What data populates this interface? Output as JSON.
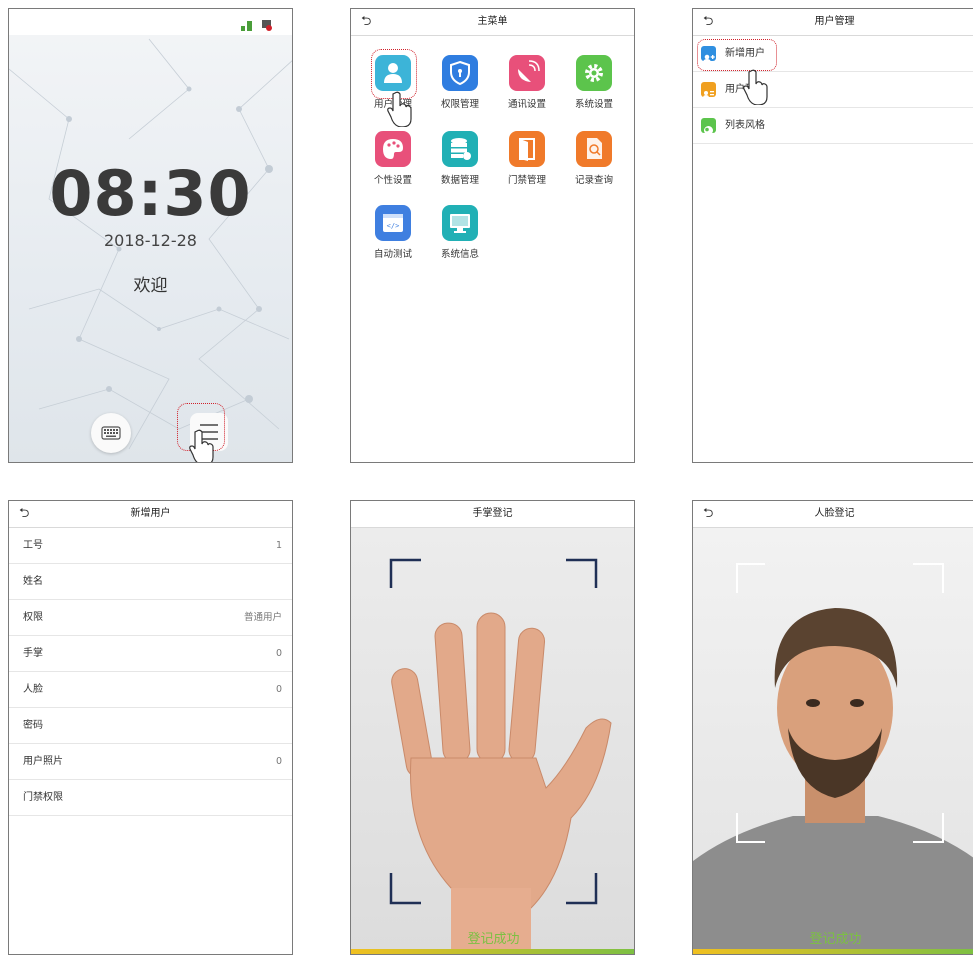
{
  "standby": {
    "time": "08:30",
    "date": "2018-12-28",
    "welcome": "欢迎",
    "keyboard_icon": "keyboard-icon",
    "menu_icon": "hamburger-menu-icon"
  },
  "main_menu": {
    "title": "主菜单",
    "items": [
      {
        "label": "用户管理",
        "icon": "user-icon",
        "color": "#3cb4d8"
      },
      {
        "label": "权限管理",
        "icon": "shield-icon",
        "color": "#2f7de0"
      },
      {
        "label": "通讯设置",
        "icon": "satellite-icon",
        "color": "#e8507a"
      },
      {
        "label": "系统设置",
        "icon": "gear-icon",
        "color": "#5cc44c"
      },
      {
        "label": "个性设置",
        "icon": "palette-icon",
        "color": "#e8507a"
      },
      {
        "label": "数据管理",
        "icon": "database-icon",
        "color": "#21b0b5"
      },
      {
        "label": "门禁管理",
        "icon": "door-icon",
        "color": "#f07a2a"
      },
      {
        "label": "记录查询",
        "icon": "record-search-icon",
        "color": "#f07a2a"
      },
      {
        "label": "自动测试",
        "icon": "code-icon",
        "color": "#3f7fe0"
      },
      {
        "label": "系统信息",
        "icon": "monitor-icon",
        "color": "#21b0b5"
      }
    ]
  },
  "user_mgmt": {
    "title": "用户管理",
    "items": [
      {
        "label": "新增用户",
        "icon": "add-user-icon",
        "color": "#2f8fe0"
      },
      {
        "label": "用户列表",
        "icon": "user-list-icon",
        "color": "#f0a020"
      },
      {
        "label": "列表风格",
        "icon": "list-style-icon",
        "color": "#5cc44c"
      }
    ]
  },
  "new_user": {
    "title": "新增用户",
    "fields": [
      {
        "label": "工号",
        "value": "1"
      },
      {
        "label": "姓名",
        "value": ""
      },
      {
        "label": "权限",
        "value": "普通用户"
      },
      {
        "label": "手掌",
        "value": "0"
      },
      {
        "label": "人脸",
        "value": "0"
      },
      {
        "label": "密码",
        "value": ""
      },
      {
        "label": "用户照片",
        "value": "0"
      },
      {
        "label": "门禁权限",
        "value": ""
      }
    ]
  },
  "palm_enroll": {
    "title": "手掌登记",
    "status": "登记成功"
  },
  "face_enroll": {
    "title": "人脸登记",
    "status": "登记成功"
  },
  "colors": {
    "highlight": "#d0202a",
    "success": "#7cc043",
    "bar_start": "#f0c020",
    "bar_end": "#7cc043"
  }
}
